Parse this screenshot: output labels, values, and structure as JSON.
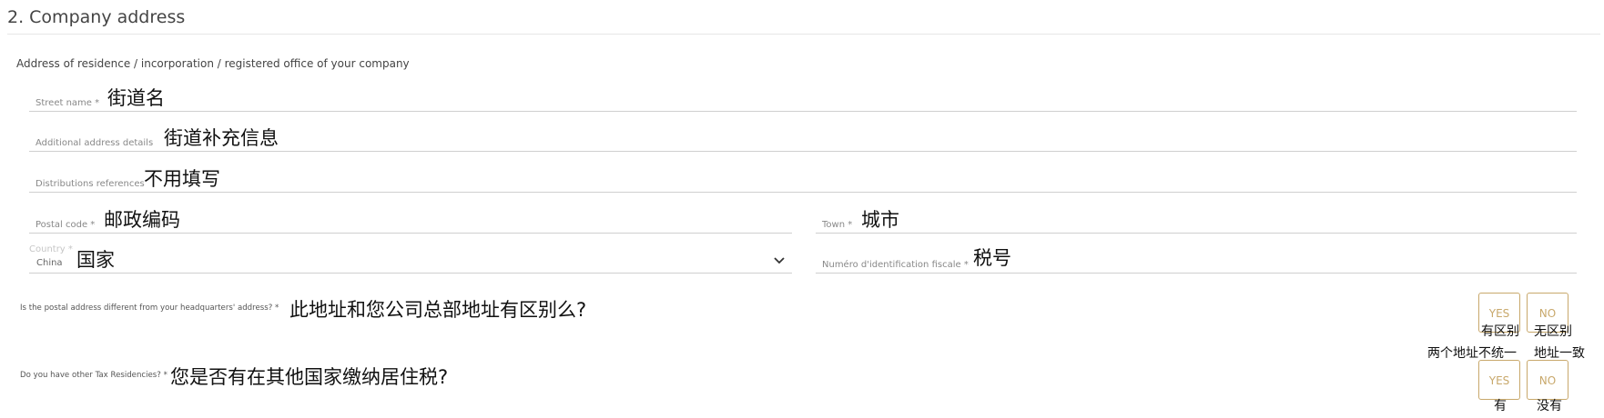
{
  "section": {
    "title": "2. Company address",
    "description": "Address of residence / incorporation / registered office of your company"
  },
  "fields": {
    "street": {
      "label": "Street name *",
      "value": "街道名"
    },
    "additional": {
      "label": "Additional address details",
      "value": "街道补充信息"
    },
    "distribution": {
      "label": "Distributions references",
      "value": "不用填写"
    },
    "postal": {
      "label": "Postal code *",
      "value": "邮政编码"
    },
    "town": {
      "label": "Town *",
      "value": "城市"
    },
    "country": {
      "label": "Country *",
      "selected": "China",
      "value": "国家"
    },
    "tax_id": {
      "label": "Numéro d'identification fiscale *",
      "value": "税号"
    }
  },
  "questions": {
    "postal_different": {
      "label": "Is the postal address different from your headquarters' address? *",
      "note": "此地址和您公司总部地址有区别么?",
      "yes": "YES",
      "no": "NO",
      "yes_note": "有区别",
      "no_note": "无区别",
      "yes_note2": "两个地址不统一",
      "no_note2": "地址一致"
    },
    "tax_residency": {
      "label": "Do you have other Tax Residencies? *",
      "note": "您是否有在其他国家缴纳居住税?",
      "yes": "YES",
      "no": "NO",
      "yes_note": "有",
      "no_note": "没有"
    }
  },
  "colors": {
    "accent": "#c8a86b"
  }
}
